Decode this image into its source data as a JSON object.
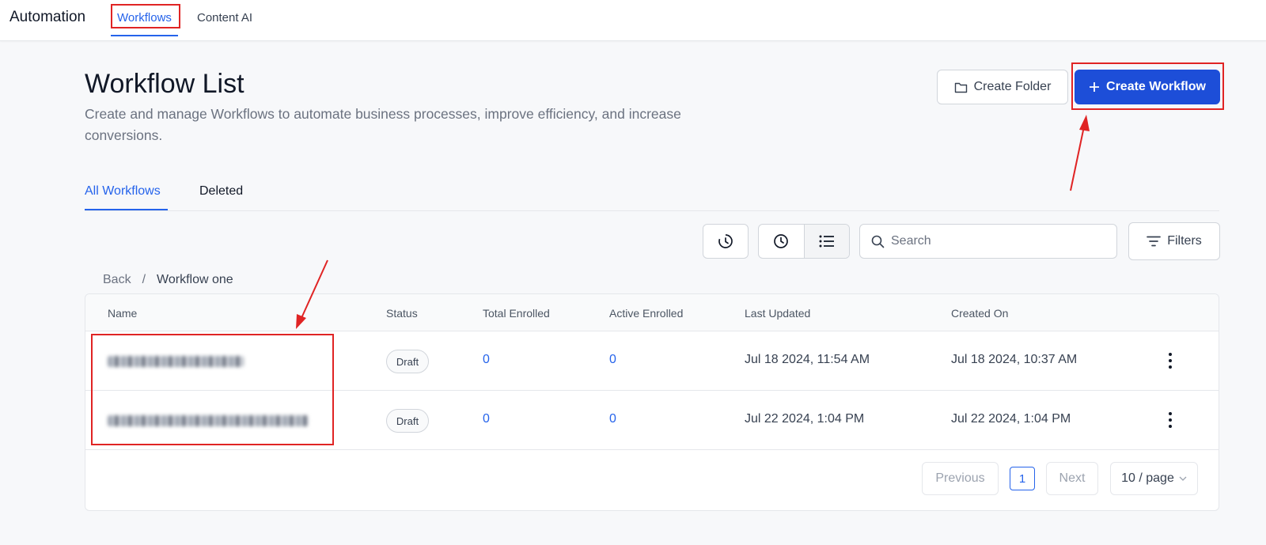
{
  "topnav": {
    "app_title": "Automation",
    "tabs": [
      "Workflows",
      "Content AI"
    ]
  },
  "header": {
    "title": "Workflow List",
    "description": "Create and manage Workflows to automate business processes, improve efficiency, and increase conversions.",
    "create_folder_label": "Create Folder",
    "create_workflow_label": "Create Workflow"
  },
  "tabs": {
    "all": "All Workflows",
    "deleted": "Deleted"
  },
  "toolbar": {
    "search_placeholder": "Search",
    "filters_label": "Filters",
    "icons": [
      "history-icon",
      "clock-icon",
      "list-view-icon",
      "search-icon",
      "filter-icon"
    ]
  },
  "breadcrumb": {
    "back": "Back",
    "separator": "/",
    "current": "Workflow one"
  },
  "table": {
    "columns": [
      "Name",
      "Status",
      "Total Enrolled",
      "Active Enrolled",
      "Last Updated",
      "Created On"
    ],
    "rows": [
      {
        "status": "Draft",
        "total_enrolled": "0",
        "active_enrolled": "0",
        "last_updated": "Jul 18 2024, 11:54 AM",
        "created_on": "Jul 18 2024, 10:37 AM"
      },
      {
        "status": "Draft",
        "total_enrolled": "0",
        "active_enrolled": "0",
        "last_updated": "Jul 22 2024, 1:04 PM",
        "created_on": "Jul 22 2024, 1:04 PM"
      }
    ]
  },
  "pagination": {
    "previous": "Previous",
    "page": "1",
    "next": "Next",
    "page_size": "10 / page"
  },
  "colors": {
    "accent": "#2563eb",
    "primary_button": "#1d4ed8",
    "annotation": "#e02424"
  }
}
